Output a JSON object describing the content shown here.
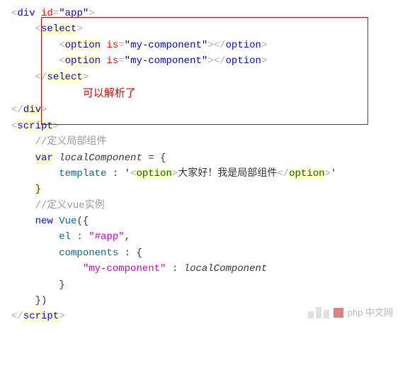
{
  "code": {
    "div_open": {
      "tag": "div",
      "attr": "id",
      "val": "\"app\""
    },
    "select_open": "select",
    "option": {
      "tag": "option",
      "attr": "is",
      "val": "\"my-component\""
    },
    "select_close": "select",
    "annotation": "可以解析了",
    "div_close": "div",
    "script_open": "script",
    "comment1": "//定义局部组件",
    "var_kw": "var",
    "local_var": "localComponent",
    "eq_brace": " = {",
    "template_key": "template",
    "template_val_prefix": " : '",
    "template_open": "<option>",
    "template_text": "大家好！我是局部组件",
    "template_close": "</option>",
    "template_val_suffix": "'",
    "close_brace": "}",
    "comment2": "//定义vue实例",
    "new_kw": "new",
    "vue_ctor": "Vue",
    "paren_brace": "({",
    "el_key": "el",
    "el_val": "\"#app\"",
    "components_key": "components",
    "comp_name": "\"my-component\"",
    "close_brace_paren": "})",
    "script_close": "script"
  },
  "watermark": "php 中文网"
}
